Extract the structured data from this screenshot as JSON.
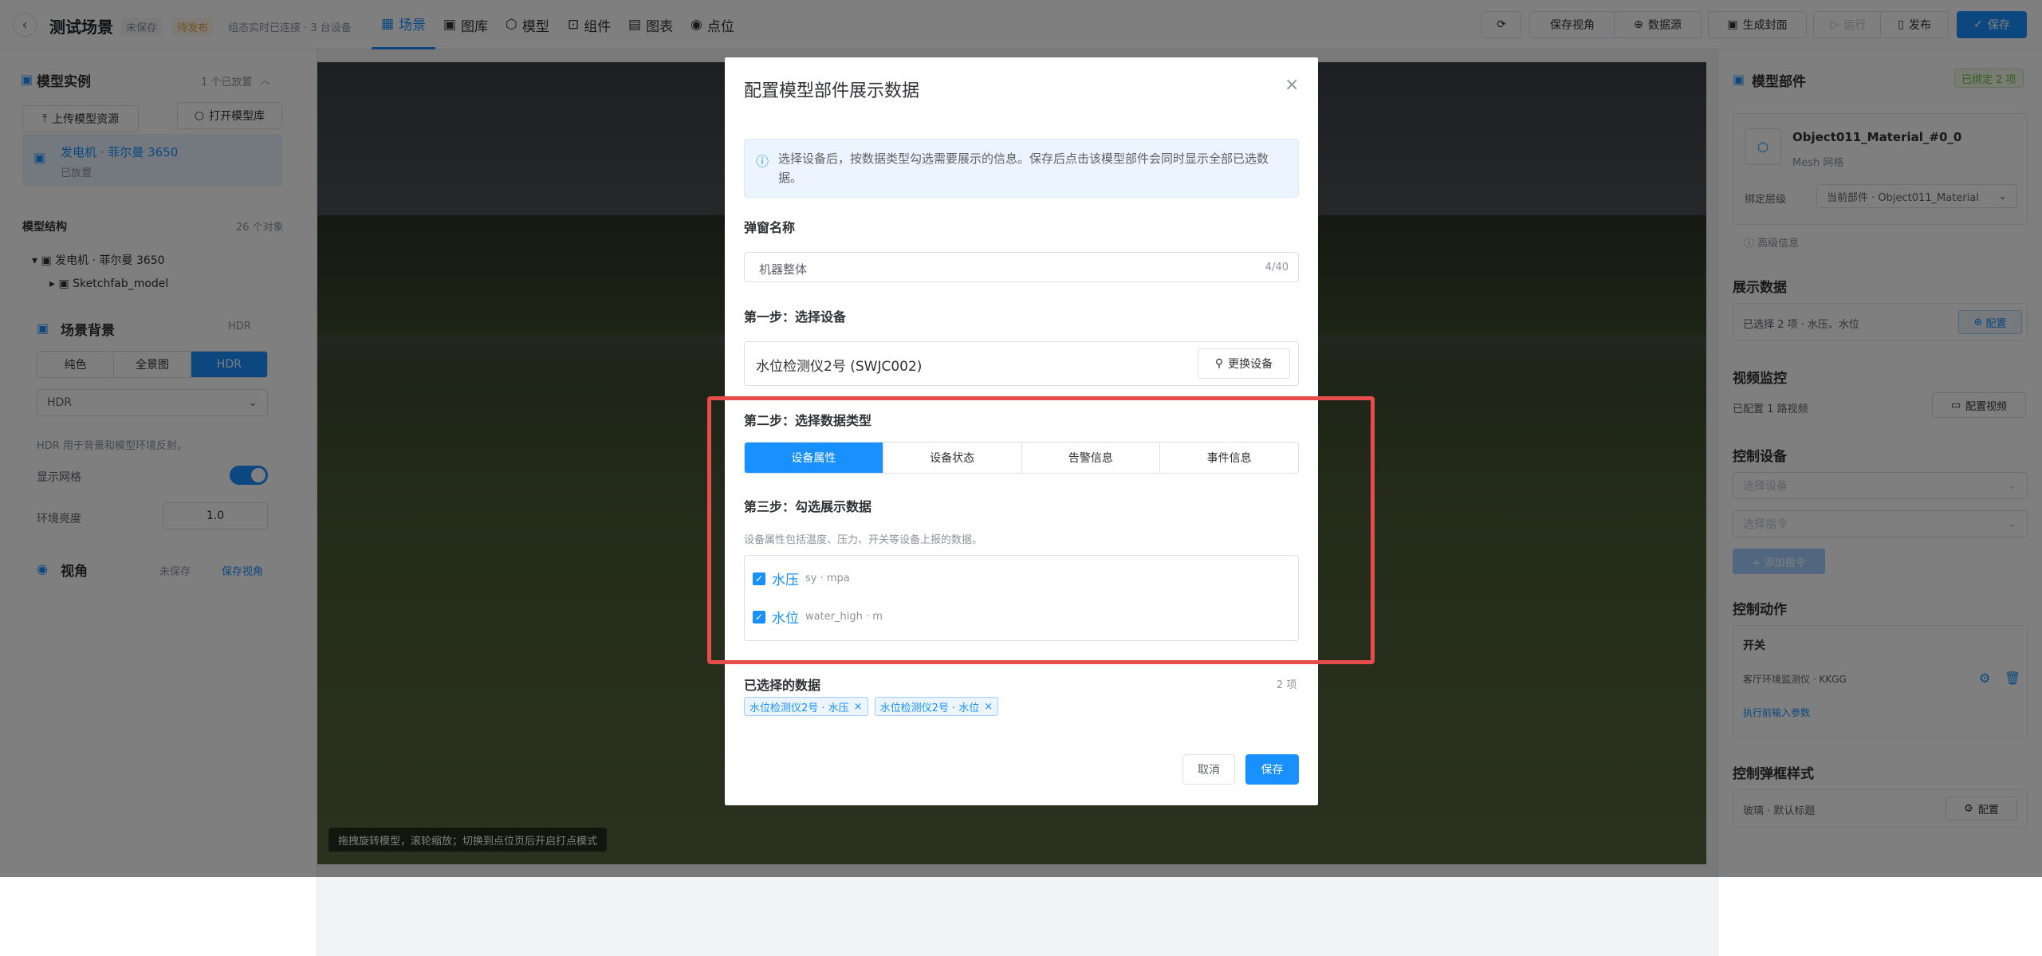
{
  "header": {
    "title": "测试场景",
    "tag_unsaved": "未保存",
    "tag_unpublished": "待发布",
    "status_text": "组态实时已连接 · 3 台设备",
    "tabs": [
      {
        "label": "场景",
        "icon": "grid-icon"
      },
      {
        "label": "图库",
        "icon": "image-icon"
      },
      {
        "label": "模型",
        "icon": "cube-icon"
      },
      {
        "label": "组件",
        "icon": "component-icon"
      },
      {
        "label": "图表",
        "icon": "chart-icon"
      },
      {
        "label": "点位",
        "icon": "pin-icon"
      }
    ],
    "actions": {
      "save_view": "保存视角",
      "datasource": "数据源",
      "generate_cover": "生成封面",
      "run": "运行",
      "publish": "发布",
      "save": "保存"
    }
  },
  "left": {
    "models_title": "模型实例",
    "models_count": "1 个已放置",
    "upload": "上传模型资源",
    "open_library": "打开模型库",
    "model_item": {
      "name": "发电机 · 菲尔曼 3650",
      "status": "已放置"
    },
    "structure_title": "模型结构",
    "structure_count": "26 个对象",
    "tree": [
      "发电机 · 菲尔曼 3650",
      "Sketchfab_model"
    ],
    "bg_title": "场景背景",
    "bg_mode": "HDR",
    "bg_tabs": [
      "纯色",
      "全景图",
      "HDR"
    ],
    "bg_select": "HDR",
    "bg_hint": "HDR 用于背景和模型环境反射。",
    "show_grid": "显示网格",
    "env_brightness": "环境亮度",
    "brightness_value": "1.0",
    "view_title": "视角",
    "view_unsaved": "未保存",
    "view_save": "保存视角"
  },
  "canvas": {
    "hint": "拖拽旋转模型，滚轮缩放；切换到点位页后开启打点模式"
  },
  "modal": {
    "title": "配置模型部件展示数据",
    "info": "选择设备后，按数据类型勾选需要展示的信息。保存后点击该模型部件会同时显示全部已选数据。",
    "popup_name_label": "弹窗名称",
    "popup_name_value": "机器整体",
    "popup_name_count": "4/40",
    "step1": "第一步：选择设备",
    "device": "水位检测仪2号 (SWJC002)",
    "change_device": "更换设备",
    "step2": "第二步：选择数据类型",
    "types": [
      "设备属性",
      "设备状态",
      "告警信息",
      "事件信息"
    ],
    "step3": "第三步：勾选展示数据",
    "step3_hint": "设备属性包括温度、压力、开关等设备上报的数据。",
    "items": [
      {
        "name": "水压",
        "meta": "sy · mpa"
      },
      {
        "name": "水位",
        "meta": "water_high · m"
      }
    ],
    "selected_label": "已选择的数据",
    "selected_count": "2 项",
    "chips": [
      "水位检测仪2号 · 水压",
      "水位检测仪2号 · 水位"
    ],
    "cancel": "取消",
    "save": "保存"
  },
  "right": {
    "title": "模型部件",
    "bound_badge": "已绑定 2 项",
    "part_name": "Object011_Material_#0_0",
    "part_type": "Mesh 网格",
    "bind_level_label": "绑定层级",
    "bind_level_value": "当前部件 · Object011_Material",
    "advanced": "高级信息",
    "display_title": "展示数据",
    "display_value": "已选择 2 项 · 水压、水位",
    "config": "配置",
    "video_title": "视频监控",
    "video_value": "已配置 1 路视频",
    "video_btn": "配置视频",
    "control_title": "控制设备",
    "select_device": "选择设备",
    "select_cmd": "选择指令",
    "add_cmd": "+ 添加指令",
    "action_title": "控制动作",
    "action_name": "开关",
    "action_device": "客厅环境监测仪 · KKGG",
    "action_link": "执行前输入参数",
    "popup_style_title": "控制弹框样式",
    "popup_style_value": "玻璃 · 默认标题",
    "popup_style_btn": "配置"
  }
}
